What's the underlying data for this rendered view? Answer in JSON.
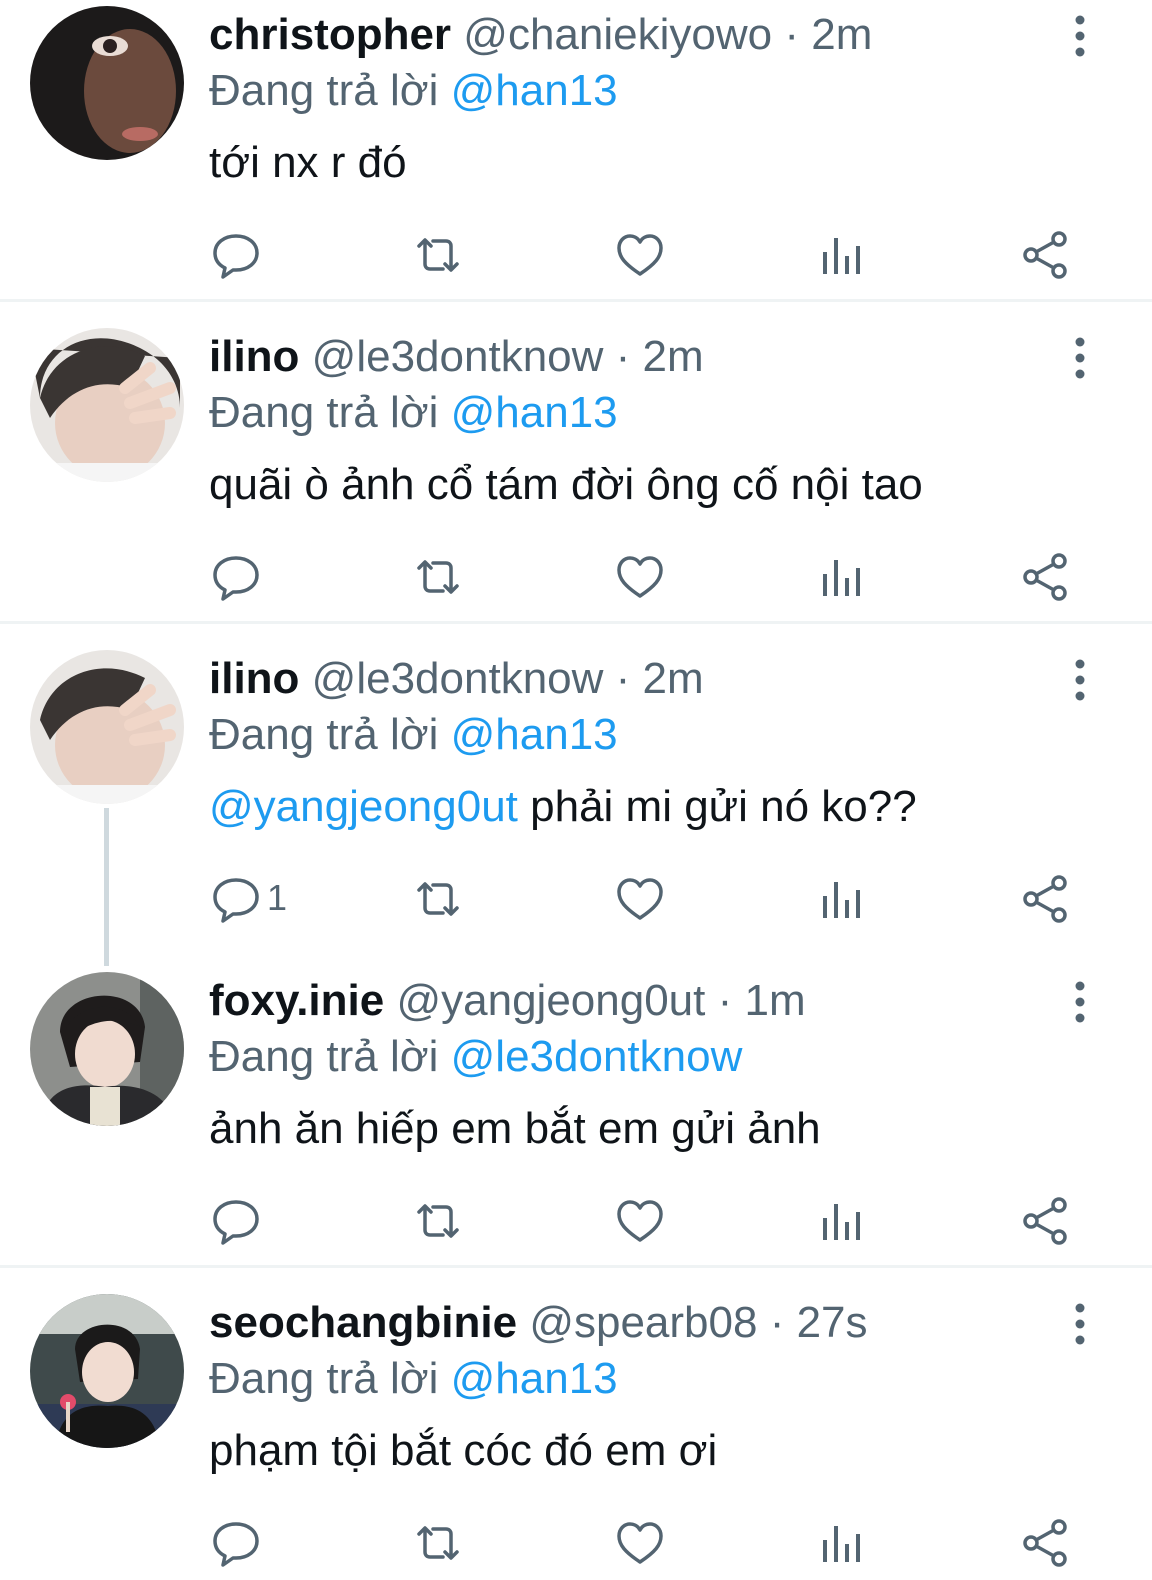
{
  "reply_prefix": "Đang trả lời",
  "accent_color": "#1d9bf0",
  "tweets": [
    {
      "name": "christopher",
      "handle": "@chaniekiyowo",
      "sep": " · ",
      "time": "2m",
      "reply_to": "@han13",
      "text": "tới nx r đó",
      "mention": "",
      "reply_count": ""
    },
    {
      "name": "ilino",
      "handle": "@le3dontknow",
      "sep": " · ",
      "time": "2m",
      "reply_to": "@han13",
      "text": "quãi ò ảnh cổ tám đời ông cố nội tao",
      "mention": "",
      "reply_count": ""
    },
    {
      "name": "ilino",
      "handle": "@le3dontknow",
      "sep": " · ",
      "time": "2m",
      "reply_to": "@han13",
      "text": " phải mi gửi nó ko??",
      "mention": "@yangjeong0ut",
      "reply_count": "1"
    },
    {
      "name": "foxy.inie",
      "handle": "@yangjeong0ut",
      "sep": " · ",
      "time": "1m",
      "reply_to": "@le3dontknow",
      "text": "ảnh ăn hiếp em bắt em gửi ảnh",
      "mention": "",
      "reply_count": ""
    },
    {
      "name": "seochangbinie",
      "handle": "@spearb08",
      "sep": " · ",
      "time": "27s",
      "reply_to": "@han13",
      "text": "phạm tội bắt cóc đó em ơi",
      "mention": "",
      "reply_count": ""
    }
  ],
  "icons": [
    "reply-icon",
    "retweet-icon",
    "like-icon",
    "views-icon",
    "share-icon",
    "more-options-icon"
  ]
}
